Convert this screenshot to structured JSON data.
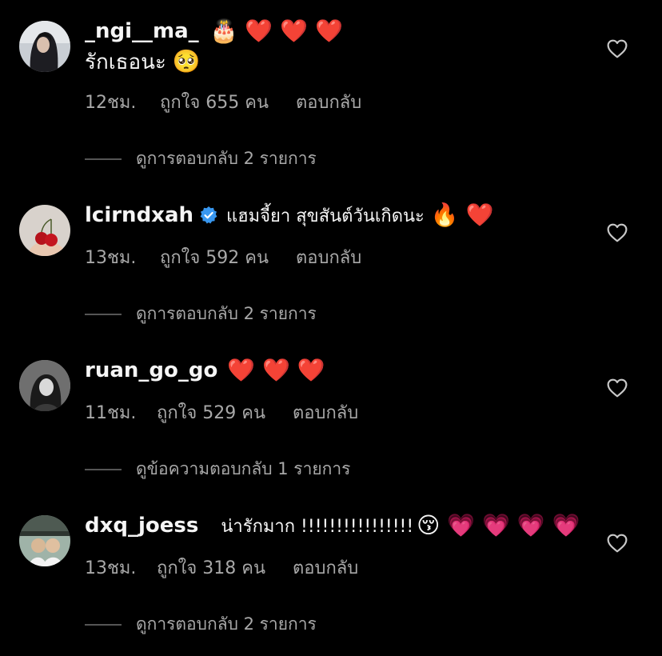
{
  "comments": [
    {
      "username": "_ngi__ma_",
      "verified": false,
      "text": "รักเธอนะ",
      "emoji_after_name": "🎂 ❤️ ❤️ ❤️",
      "emoji_after_text": "🥺",
      "time": "12ชม.",
      "likes": "ถูกใจ 655 คน",
      "reply": "ตอบกลับ",
      "view_replies": "ดูการตอบกลับ 2 รายการ"
    },
    {
      "username": "lcirndxah",
      "verified": true,
      "text": "แฮมจี้ยา สุขสันต์วันเกิดนะ",
      "emoji_after_text": "🔥 ❤️",
      "time": "13ชม.",
      "likes": "ถูกใจ 592 คน",
      "reply": "ตอบกลับ",
      "view_replies": "ดูการตอบกลับ 2 รายการ"
    },
    {
      "username": "ruan_go_go",
      "verified": false,
      "text": "",
      "emoji_after_text": "❤️ ❤️ ❤️",
      "time": "11ชม.",
      "likes": "ถูกใจ 529 คน",
      "reply": "ตอบกลับ",
      "view_replies": "ดูข้อความตอบกลับ 1 รายการ"
    },
    {
      "username": "dxq_joess",
      "verified": false,
      "text": "น่ารักมาก !!!!!!!!!!!!!!!!",
      "emoji_after_text": "😚 💗 💗 💗 💗",
      "time": "13ชม.",
      "likes": "ถูกใจ 318 คน",
      "reply": "ตอบกลับ",
      "view_replies": "ดูการตอบกลับ 2 รายการ"
    }
  ],
  "icons": {
    "like": "heart-outline-icon",
    "verified": "verified-badge-icon"
  },
  "colors": {
    "background": "#000000",
    "primary_text": "#f5f5f5",
    "secondary_text": "#a8a8a8",
    "verified_blue": "#3897f0"
  }
}
